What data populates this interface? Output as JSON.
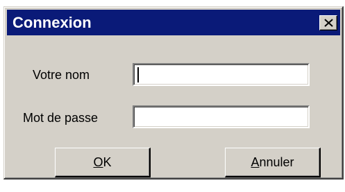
{
  "window": {
    "title": "Connexion",
    "close_icon": "close-icon",
    "titlebar_color": "#0a1a78",
    "body_color": "#d4d0c8"
  },
  "form": {
    "name_label": "Votre nom",
    "name_value": "",
    "password_label": "Mot de passe",
    "password_value": ""
  },
  "buttons": {
    "ok_mnemonic": "O",
    "ok_rest": "K",
    "cancel_mnemonic": "A",
    "cancel_rest": "nnuler"
  }
}
